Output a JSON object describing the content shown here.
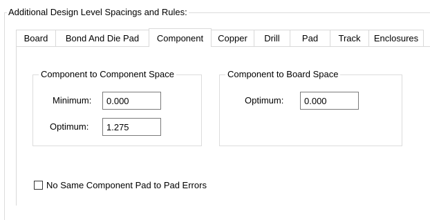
{
  "section": {
    "title": "Additional Design Level Spacings and Rules:"
  },
  "tabs": [
    {
      "label": "Board"
    },
    {
      "label": "Bond And Die Pad"
    },
    {
      "label": "Component",
      "active": true
    },
    {
      "label": "Copper"
    },
    {
      "label": "Drill"
    },
    {
      "label": "Pad"
    },
    {
      "label": "Track"
    },
    {
      "label": "Enclosures"
    }
  ],
  "component_to_component": {
    "title": "Component to Component Space",
    "minimum_label": "Minimum:",
    "minimum_value": "0.000",
    "optimum_label": "Optimum:",
    "optimum_value": "1.275"
  },
  "component_to_board": {
    "title": "Component to Board Space",
    "optimum_label": "Optimum:",
    "optimum_value": "0.000"
  },
  "no_same_component_pad_errors": {
    "label": "No Same Component Pad to Pad Errors",
    "checked": false
  }
}
